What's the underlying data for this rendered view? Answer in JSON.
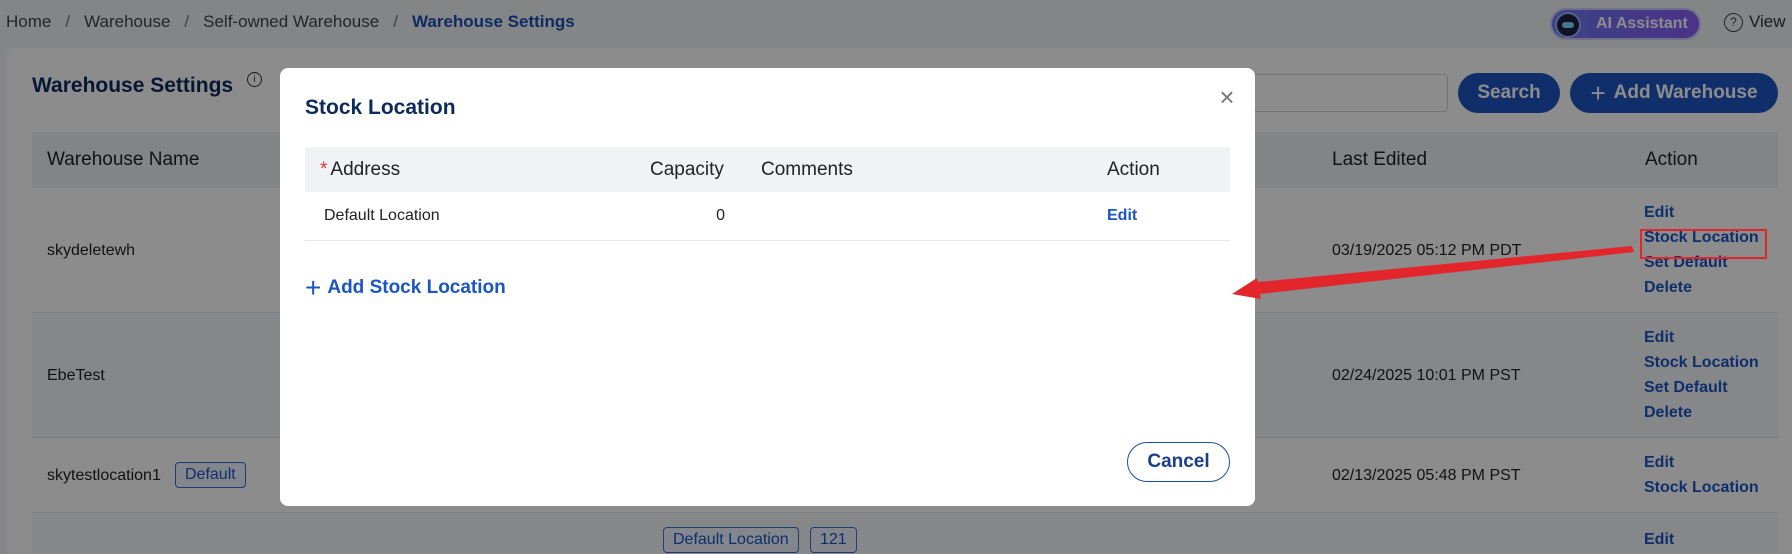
{
  "breadcrumb": {
    "items": [
      "Home",
      "Warehouse",
      "Self-owned Warehouse"
    ],
    "current": "Warehouse Settings",
    "separator": "/"
  },
  "header": {
    "ai_label": "AI Assistant",
    "view_label": "View",
    "help_icon_glyph": "?"
  },
  "page": {
    "title": "Warehouse Settings",
    "info_icon_glyph": "i",
    "search_label": "Search",
    "add_label": "Add Warehouse",
    "plus_glyph": "+"
  },
  "table": {
    "headers": {
      "name": "Warehouse Name",
      "last_edited": "Last Edited",
      "action": "Action"
    },
    "rows": [
      {
        "name": "skydeletewh",
        "last_edited": "03/19/2025 05:12 PM PDT",
        "actions": [
          "Edit",
          "Stock Location",
          "Set Default",
          "Delete"
        ]
      },
      {
        "name": "EbeTest",
        "last_edited": "02/24/2025 10:01 PM PST",
        "actions": [
          "Edit",
          "Stock Location",
          "Set Default",
          "Delete"
        ]
      },
      {
        "name": "skytestlocation1",
        "badge": "Default",
        "last_edited": "02/13/2025 05:48 PM PST",
        "actions": [
          "Edit",
          "Stock Location"
        ]
      },
      {
        "location_tag": "Default Location",
        "count_tag": "121",
        "actions": [
          "Edit"
        ]
      }
    ]
  },
  "modal": {
    "title": "Stock Location",
    "close_glyph": "×",
    "required_mark": "*",
    "headers": {
      "address": "Address",
      "capacity": "Capacity",
      "comments": "Comments",
      "action": "Action"
    },
    "rows": [
      {
        "address": "Default Location",
        "capacity": "0",
        "comments": "",
        "action": "Edit"
      }
    ],
    "add_label": "Add Stock Location",
    "plus_glyph": "+",
    "cancel_label": "Cancel"
  },
  "colors": {
    "primary": "#1e56c2",
    "title": "#0d2a5c",
    "highlight": "#e3262b"
  }
}
